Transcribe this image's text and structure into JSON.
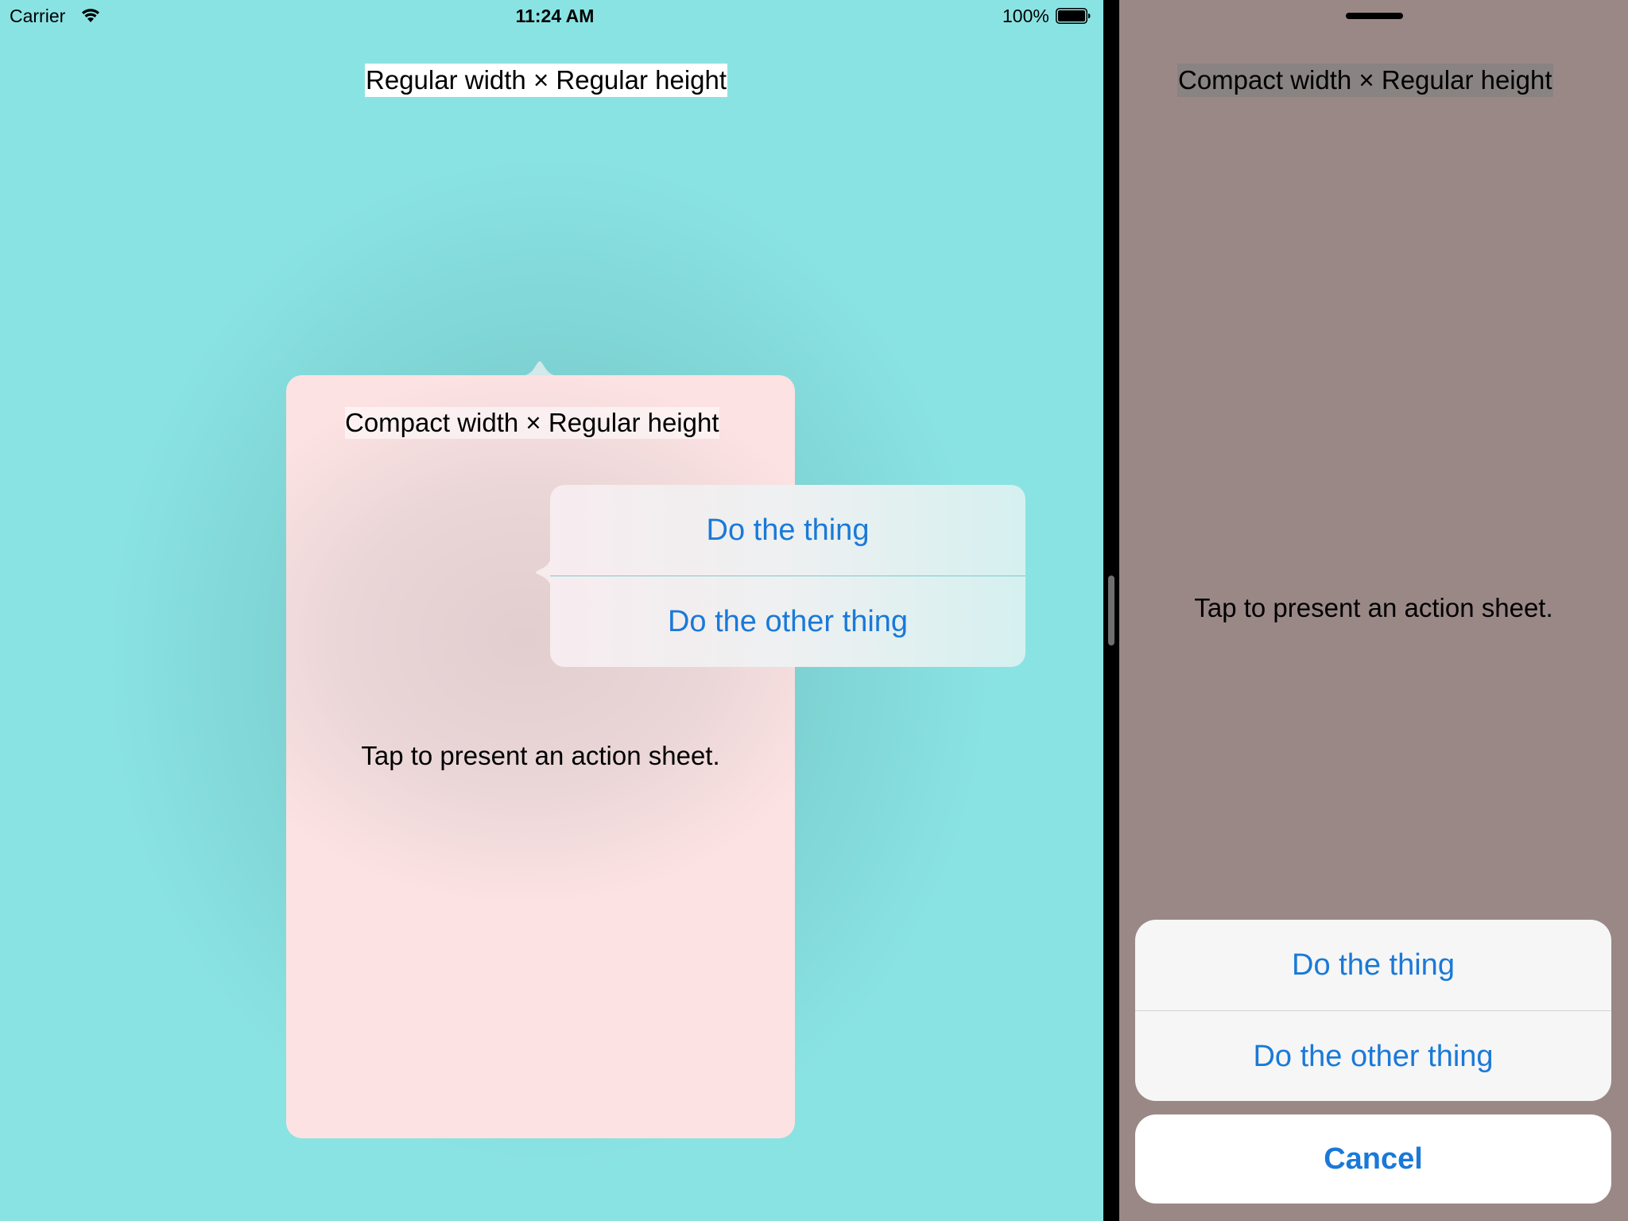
{
  "status_bar": {
    "carrier": "Carrier",
    "time": "11:24 AM",
    "battery": "100%"
  },
  "left_app": {
    "title": "Regular width × Regular height",
    "popover": {
      "title": "Compact width × Regular height",
      "body": "Tap to present an action sheet.",
      "action_sheet": {
        "option_1": "Do the thing",
        "option_2": "Do the other thing"
      }
    }
  },
  "right_app": {
    "title": "Compact width × Regular height",
    "body": "Tap to present an action sheet.",
    "action_sheet": {
      "option_1": "Do the thing",
      "option_2": "Do the other thing",
      "cancel": "Cancel"
    }
  },
  "colors": {
    "accent": "#1a79d8",
    "left_background": "#8ae3e3",
    "popover_background": "#fde2e3",
    "right_background": "#9a8887"
  }
}
